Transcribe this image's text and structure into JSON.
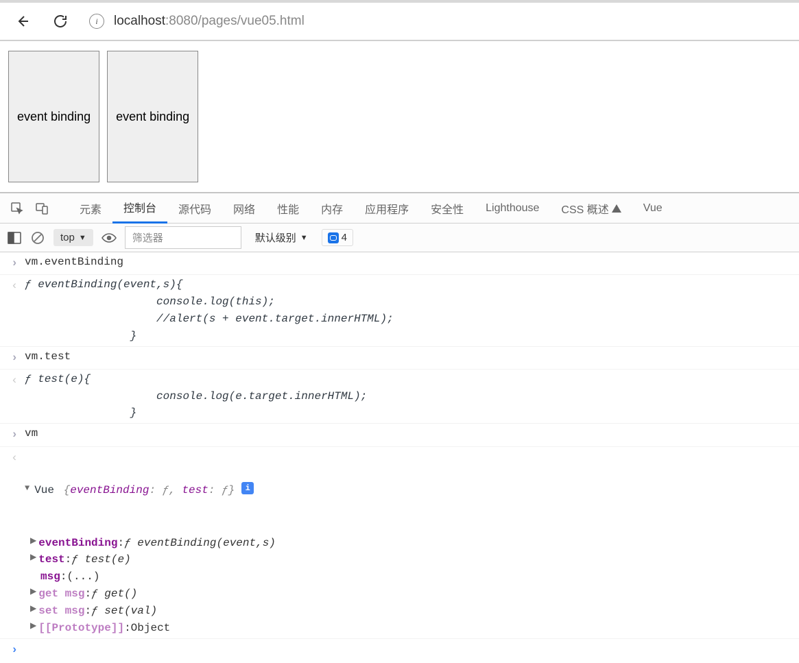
{
  "url": {
    "host_prefix": "localhost",
    "host_dim": ":8080/pages/vue05.html"
  },
  "page": {
    "button1": "event binding",
    "button2": "event binding"
  },
  "devtools_tabs": {
    "elements": "元素",
    "console": "控制台",
    "sources": "源代码",
    "network": "网络",
    "performance": "性能",
    "memory": "内存",
    "application": "应用程序",
    "security": "安全性",
    "lighthouse": "Lighthouse",
    "css_overview": "CSS 概述",
    "vue": "Vue"
  },
  "console_toolbar": {
    "context": "top",
    "filter_placeholder": "筛选器",
    "level": "默认级别",
    "msg_count": "4"
  },
  "console": {
    "line1_in": "vm.eventBinding",
    "line1_out": "ƒ eventBinding(event,s){\n                    console.log(this);\n                    //alert(s + event.target.innerHTML);\n                }",
    "line2_in": "vm.test",
    "line2_out": "ƒ test(e){\n                    console.log(e.target.innerHTML);\n                }",
    "line3_in": "vm",
    "vue_header_cls": "Vue ",
    "vue_header_preview": "{eventBinding: ƒ, test: ƒ}",
    "props": {
      "eventBinding_key": "eventBinding",
      "eventBinding_val": "ƒ eventBinding(event,s)",
      "test_key": "test",
      "test_val": "ƒ test(e)",
      "msg_key": "msg",
      "msg_val": "(...)",
      "getmsg_key": "get msg",
      "getmsg_val": "ƒ get()",
      "setmsg_key": "set msg",
      "setmsg_val": "ƒ set(val)",
      "proto_key": "[[Prototype]]",
      "proto_val": "Object"
    }
  }
}
